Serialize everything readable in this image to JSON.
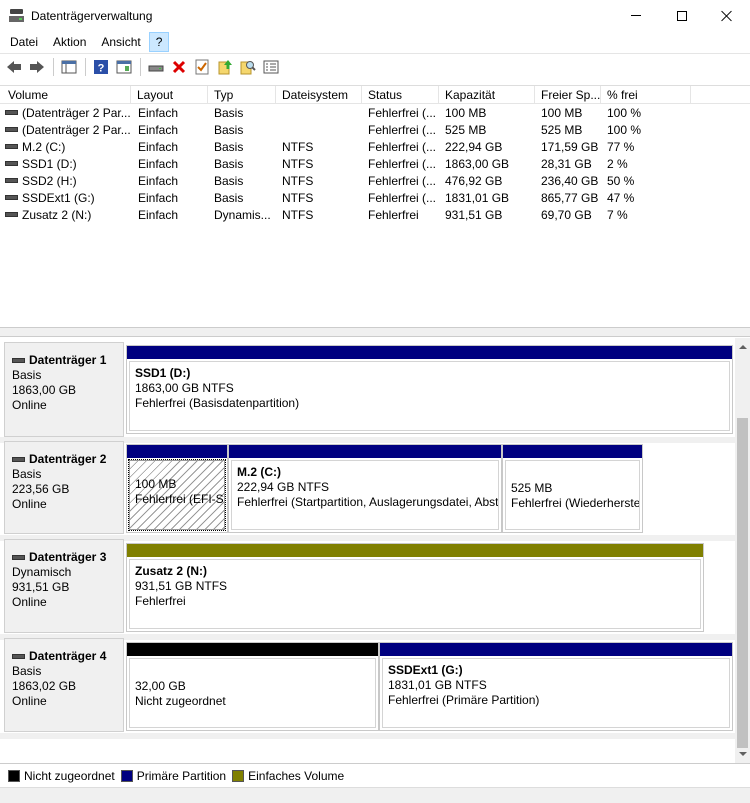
{
  "window": {
    "title": "Datenträgerverwaltung"
  },
  "menu": [
    "Datei",
    "Aktion",
    "Ansicht",
    "?"
  ],
  "toolbar_icons": [
    "back-arrow-icon",
    "forward-arrow-icon",
    "console-tree-icon",
    "help-icon",
    "properties-icon",
    "connect-drive-icon",
    "delete-icon",
    "check-icon",
    "upload-icon",
    "search-icon",
    "list-view-icon"
  ],
  "columns": [
    "Volume",
    "Layout",
    "Typ",
    "Dateisystem",
    "Status",
    "Kapazität",
    "Freier Sp...",
    "% frei"
  ],
  "volumes": [
    [
      "(Datenträger 2 Par...",
      "Einfach",
      "Basis",
      "",
      "Fehlerfrei (...",
      "100 MB",
      "100 MB",
      "100 %"
    ],
    [
      "(Datenträger 2 Par...",
      "Einfach",
      "Basis",
      "",
      "Fehlerfrei (...",
      "525 MB",
      "525 MB",
      "100 %"
    ],
    [
      "M.2 (C:)",
      "Einfach",
      "Basis",
      "NTFS",
      "Fehlerfrei (...",
      "222,94 GB",
      "171,59 GB",
      "77 %"
    ],
    [
      "SSD1 (D:)",
      "Einfach",
      "Basis",
      "NTFS",
      "Fehlerfrei (...",
      "1863,00 GB",
      "28,31 GB",
      "2 %"
    ],
    [
      "SSD2 (H:)",
      "Einfach",
      "Basis",
      "NTFS",
      "Fehlerfrei (...",
      "476,92 GB",
      "236,40 GB",
      "50 %"
    ],
    [
      "SSDExt1 (G:)",
      "Einfach",
      "Basis",
      "NTFS",
      "Fehlerfrei (...",
      "1831,01 GB",
      "865,77 GB",
      "47 %"
    ],
    [
      "Zusatz 2 (N:)",
      "Einfach",
      "Dynamis...",
      "NTFS",
      "Fehlerfrei",
      "931,51 GB",
      "69,70 GB",
      "7 %"
    ]
  ],
  "disks": [
    {
      "name": "Datenträger 1",
      "type": "Basis",
      "size": "1863,00 GB",
      "state": "Online",
      "partitions": [
        {
          "name": "SSD1  (D:)",
          "size": "1863,00 GB NTFS",
          "status": "Fehlerfrei (Basisdatenpartition)",
          "color": "#000080"
        }
      ]
    },
    {
      "name": "Datenträger 2",
      "type": "Basis",
      "size": "223,56 GB",
      "state": "Online",
      "partitions": [
        {
          "name": "",
          "size": "100 MB",
          "status": "Fehlerfrei (EFI-Sy",
          "color": "#000080"
        },
        {
          "name": "M.2  (C:)",
          "size": "222,94 GB NTFS",
          "status": "Fehlerfrei (Startpartition, Auslagerungsdatei, Abst",
          "color": "#000080"
        },
        {
          "name": "",
          "size": "525 MB",
          "status": "Fehlerfrei (Wiederherste",
          "color": "#000080"
        }
      ]
    },
    {
      "name": "Datenträger 3",
      "type": "Dynamisch",
      "size": "931,51 GB",
      "state": "Online",
      "partitions": [
        {
          "name": "Zusatz 2  (N:)",
          "size": "931,51 GB NTFS",
          "status": "Fehlerfrei",
          "color": "#808000"
        }
      ]
    },
    {
      "name": "Datenträger 4",
      "type": "Basis",
      "size": "1863,02 GB",
      "state": "Online",
      "partitions": [
        {
          "name": "",
          "size": "32,00 GB",
          "status": "Nicht zugeordnet",
          "color": "#000000"
        },
        {
          "name": "SSDExt1  (G:)",
          "size": "1831,01 GB NTFS",
          "status": "Fehlerfrei (Primäre Partition)",
          "color": "#000080"
        }
      ]
    }
  ],
  "legend": [
    {
      "label": "Nicht zugeordnet",
      "color": "#000000"
    },
    {
      "label": "Primäre Partition",
      "color": "#000080"
    },
    {
      "label": "Einfaches Volume",
      "color": "#808000"
    }
  ]
}
